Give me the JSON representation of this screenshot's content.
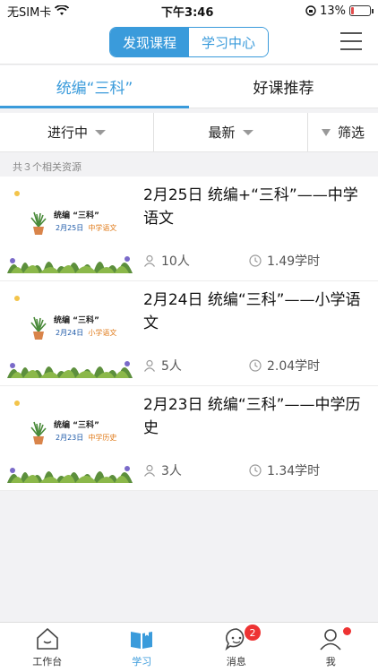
{
  "status": {
    "carrier": "无SIM卡",
    "time": "下午3:46",
    "battery_percent": "13%",
    "battery_level": 0.13
  },
  "nav": {
    "seg_active": "发现课程",
    "seg_inactive": "学习中心"
  },
  "tabs": [
    {
      "label": "统编“三科”",
      "active": true
    },
    {
      "label": "好课推荐",
      "active": false
    }
  ],
  "filters": {
    "status": "进行中",
    "sort": "最新",
    "screen": "筛选"
  },
  "count_text": "共３个相关资源",
  "thumb": {
    "title": "统编 “三科”"
  },
  "items": [
    {
      "title": "2月25日 统编+“三科”——中学语文",
      "thumb_date": "2月25日",
      "thumb_subject": "中学语文",
      "people": "10人",
      "hours": "1.49学时"
    },
    {
      "title": "2月24日 统编“三科”——小学语文",
      "thumb_date": "2月24日",
      "thumb_subject": "小学语文",
      "people": "5人",
      "hours": "2.04学时"
    },
    {
      "title": "2月23日 统编“三科”——中学历史",
      "thumb_date": "2月23日",
      "thumb_subject": "中学历史",
      "people": "3人",
      "hours": "1.34学时"
    }
  ],
  "bottom": {
    "workbench": "工作台",
    "study": "学习",
    "messages": "消息",
    "messages_badge": "2",
    "me": "我"
  },
  "colors": {
    "accent": "#3a9bdb",
    "badge": "#ee3333"
  }
}
